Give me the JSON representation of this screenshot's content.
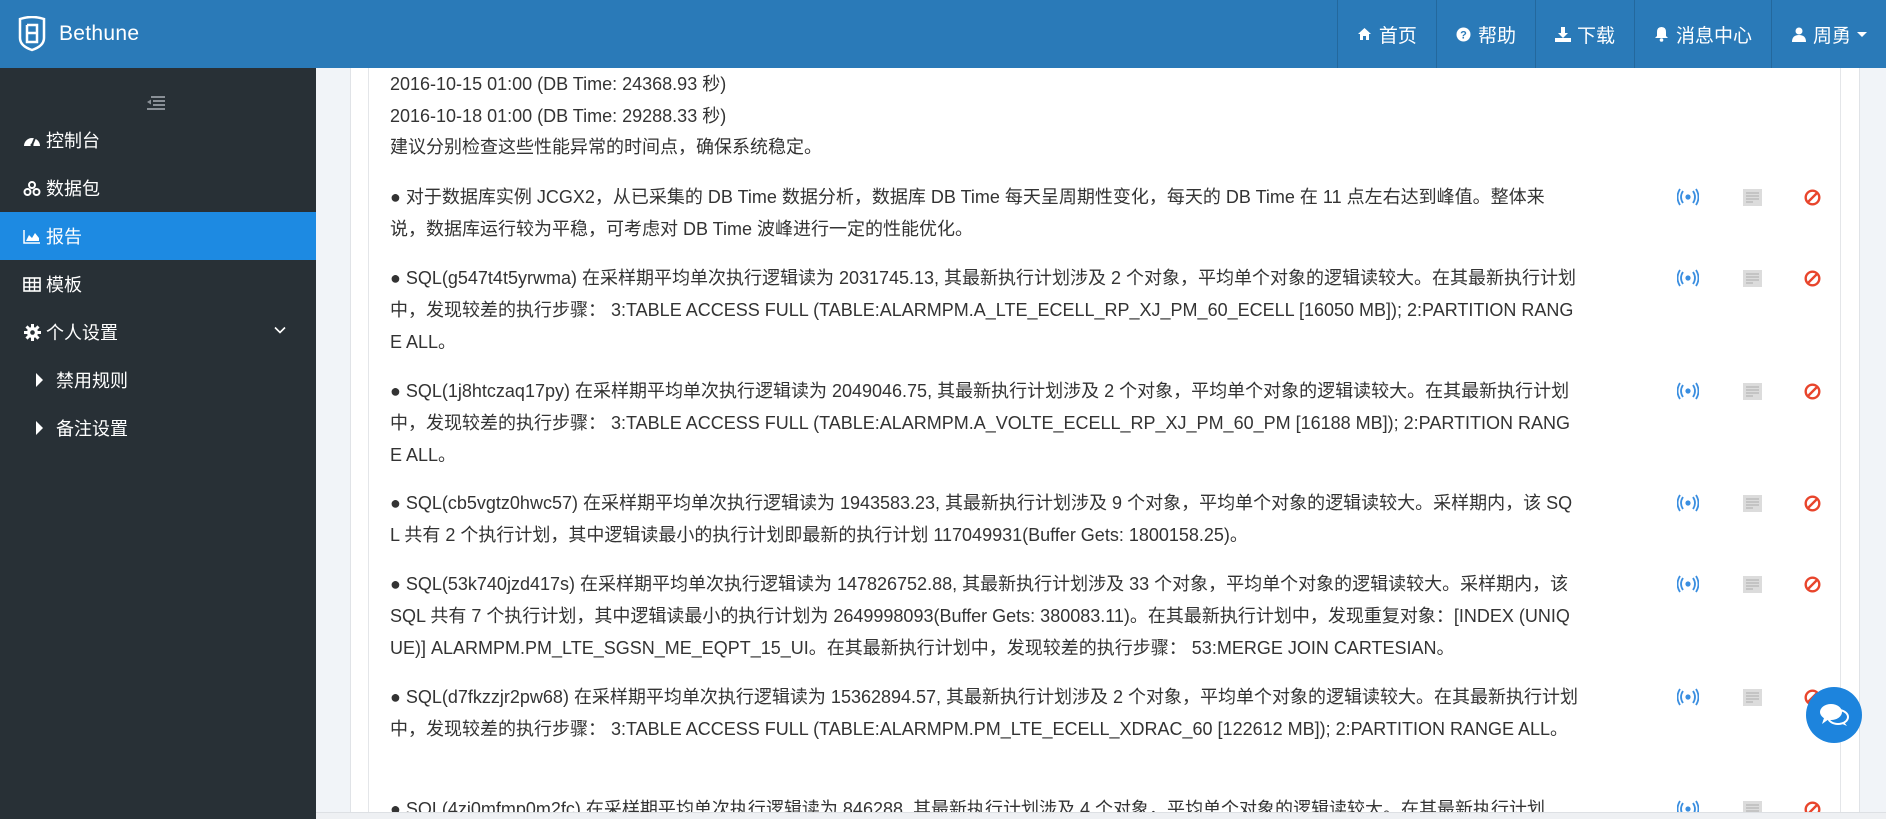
{
  "header": {
    "brand": "Bethune",
    "nav": [
      {
        "icon": "home-icon",
        "label": "首页"
      },
      {
        "icon": "help-icon",
        "label": "帮助"
      },
      {
        "icon": "download-icon",
        "label": "下载"
      },
      {
        "icon": "bell-icon",
        "label": "消息中心"
      },
      {
        "icon": "user-icon",
        "label": "周勇"
      }
    ]
  },
  "sidebar": {
    "items": [
      {
        "icon": "dashboard-icon",
        "label": "控制台"
      },
      {
        "icon": "cubes-icon",
        "label": "数据包"
      },
      {
        "icon": "area-chart-icon",
        "label": "报告",
        "active": true
      },
      {
        "icon": "table-icon",
        "label": "模板"
      },
      {
        "icon": "gear-icon",
        "label": "个人设置",
        "expanded": true
      }
    ],
    "subitems": [
      {
        "label": "禁用规则"
      },
      {
        "label": "备注设置"
      }
    ]
  },
  "content": {
    "lines": [
      "2016-10-15 01:00 (DB Time: 24368.93 秒)",
      "2016-10-18 01:00 (DB Time: 29288.33 秒)",
      "建议分别检查这些性能异常的时间点，确保系统稳定。"
    ],
    "findings": [
      {
        "text": "● 对于数据库实例 JCGX2，从已采集的 DB Time 数据分析，数据库 DB Time 每天呈周期性变化，每天的 DB Time 在 11 点左右达到峰值。整体来说，数据库运行较为平稳，可考虑对 DB Time 波峰进行一定的性能优化。"
      },
      {
        "text": "● SQL(g547t4t5yrwma) 在采样期平均单次执行逻辑读为 2031745.13, 其最新执行计划涉及 2 个对象，平均单个对象的逻辑读较大。在其最新执行计划中，发现较差的执行步骤： 3:TABLE ACCESS FULL (TABLE:ALARMPM.A_LTE_ECELL_RP_XJ_PM_60_ECELL [16050 MB]);  2:PARTITION RANGE ALL。"
      },
      {
        "text": "● SQL(1j8htczaq17py) 在采样期平均单次执行逻辑读为 2049046.75, 其最新执行计划涉及 2 个对象，平均单个对象的逻辑读较大。在其最新执行计划中，发现较差的执行步骤： 3:TABLE ACCESS FULL (TABLE:ALARMPM.A_VOLTE_ECELL_RP_XJ_PM_60_PM [16188 MB]);  2:PARTITION RANGE ALL。"
      },
      {
        "text": "● SQL(cb5vgtz0hwc57) 在采样期平均单次执行逻辑读为 1943583.23, 其最新执行计划涉及 9 个对象，平均单个对象的逻辑读较大。采样期内，该 SQL 共有 2 个执行计划，其中逻辑读最小的执行计划即最新的执行计划 117049931(Buffer Gets: 1800158.25)。"
      },
      {
        "text": "● SQL(53k740jzd417s) 在采样期平均单次执行逻辑读为 147826752.88, 其最新执行计划涉及 33 个对象，平均单个对象的逻辑读较大。采样期内，该 SQL 共有 7 个执行计划，其中逻辑读最小的执行计划为 2649998093(Buffer Gets: 380083.11)。在其最新执行计划中，发现重复对象：[INDEX (UNIQUE)] ALARMPM.PM_LTE_SGSN_ME_EQPT_15_UI。在其最新执行计划中，发现较差的执行步骤： 53:MERGE JOIN CARTESIAN。"
      },
      {
        "text": "● SQL(d7fkzzjr2pw68) 在采样期平均单次执行逻辑读为 15362894.57, 其最新执行计划涉及 2 个对象，平均单个对象的逻辑读较大。在其最新执行计划中，发现较差的执行步骤： 3:TABLE ACCESS FULL (TABLE:ALARMPM.PM_LTE_ECELL_XDRAC_60 [122612 MB]);  2:PARTITION RANGE ALL。"
      },
      {
        "text": "● SQL(4zj0mfmp0m2fc) 在采样期平均单次执行逻辑读为 846288, 其最新执行计划涉及 4 个对象，平均单个对象的逻辑读较大。在其最新执行计划"
      }
    ],
    "actions": {
      "track": "broadcast-icon",
      "note": "note-icon",
      "disable": "ban-icon"
    }
  },
  "colors": {
    "header": "#2a7ab8",
    "sidebar": "#283036",
    "active": "#1d8ae2",
    "track_icon": "#3a8ee0",
    "ban_icon": "#e8452c"
  }
}
